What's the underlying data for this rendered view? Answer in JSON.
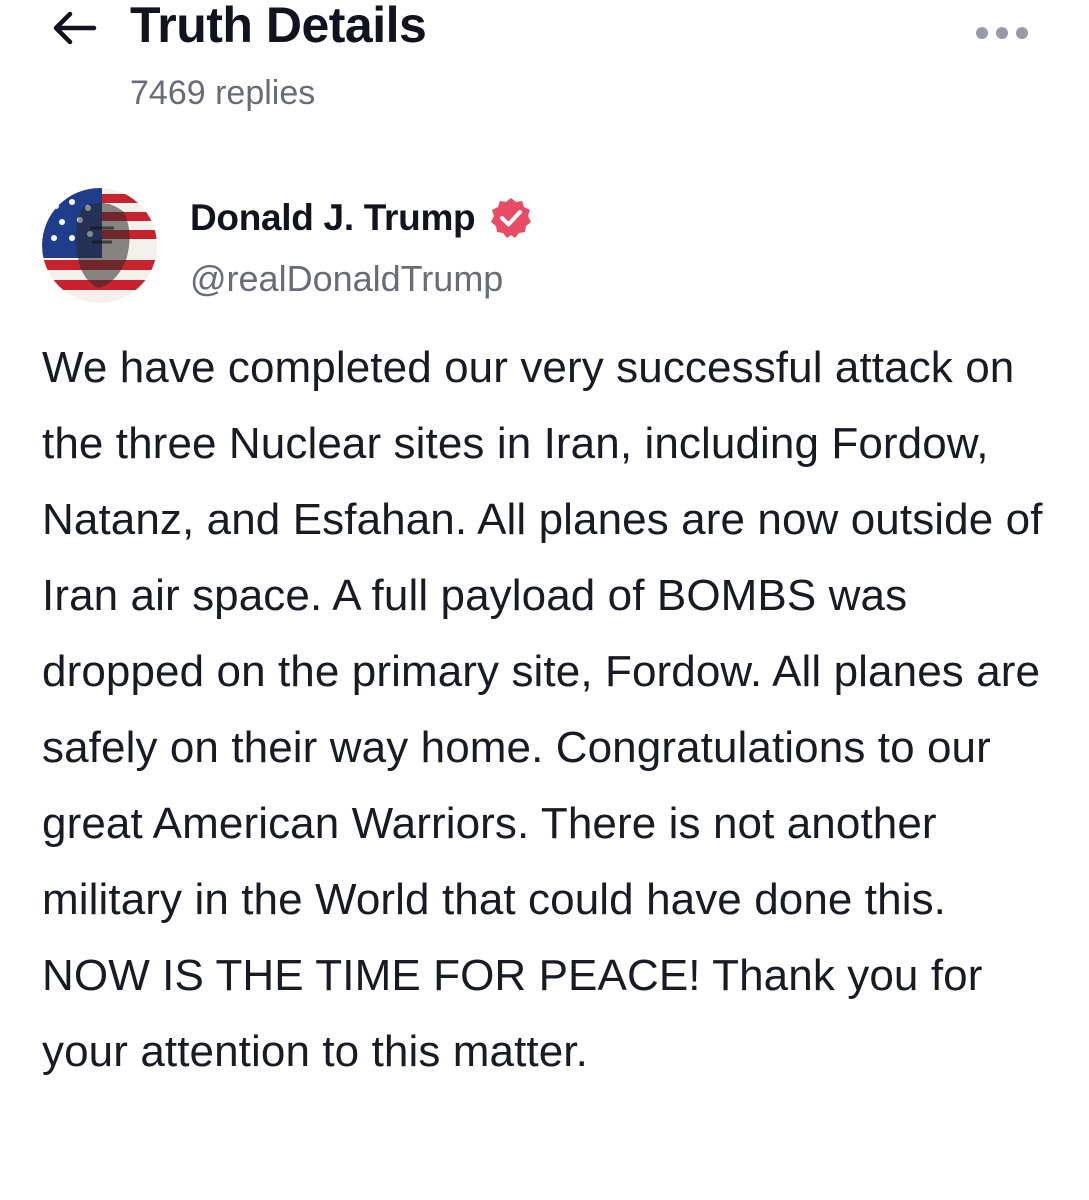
{
  "header": {
    "title": "Truth Details",
    "reply_count": "7469 replies",
    "back_icon": "arrow-left-icon",
    "more_icon": "ellipsis-icon"
  },
  "post": {
    "author": {
      "name": "Donald J. Trump",
      "handle": "@realDonaldTrump",
      "verified_icon": "verified-badge-icon",
      "verified_color": "#e94b64"
    },
    "text": "We have completed our very successful attack on the three Nuclear sites in Iran, including Fordow, Natanz, and Esfahan. All planes are now outside of Iran air space. A full payload of BOMBS was dropped on the primary site, Fordow. All planes are safely on their way home. Congratulations to our great American Warriors. There is not another military in the World that could have done this. NOW IS THE TIME FOR PEACE! Thank you for your attention to this matter."
  }
}
